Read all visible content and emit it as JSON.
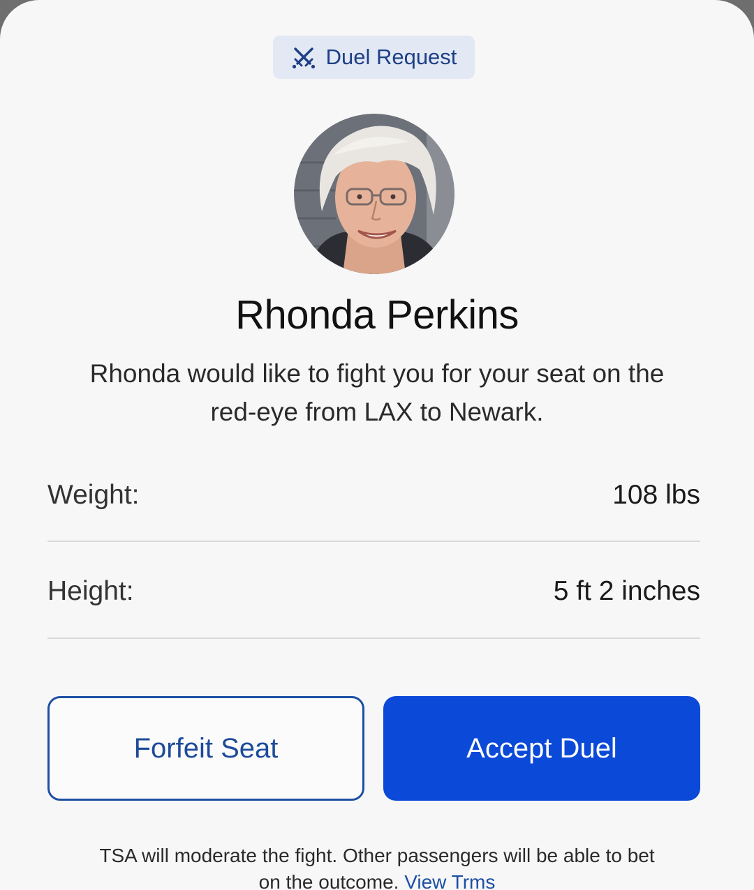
{
  "badge": {
    "icon": "crossed-swords-icon",
    "label": "Duel Request"
  },
  "profile": {
    "avatar": "avatar-photo",
    "name": "Rhonda Perkins",
    "description": "Rhonda would like to fight you for your seat on the red-eye from LAX to Newark."
  },
  "stats": [
    {
      "label": "Weight:",
      "value": "108 lbs"
    },
    {
      "label": "Height:",
      "value": "5 ft 2 inches"
    }
  ],
  "actions": {
    "forfeit_label": "Forfeit Seat",
    "accept_label": "Accept Duel"
  },
  "footer": {
    "text": "TSA will moderate the fight. Other passengers will be able to bet on the outcome. ",
    "link_label": "View Trms"
  },
  "colors": {
    "accent": "#0b49d8",
    "badge_bg": "#e2e8f4",
    "badge_text": "#1e3f86",
    "outline_button": "#1d4fa3"
  }
}
